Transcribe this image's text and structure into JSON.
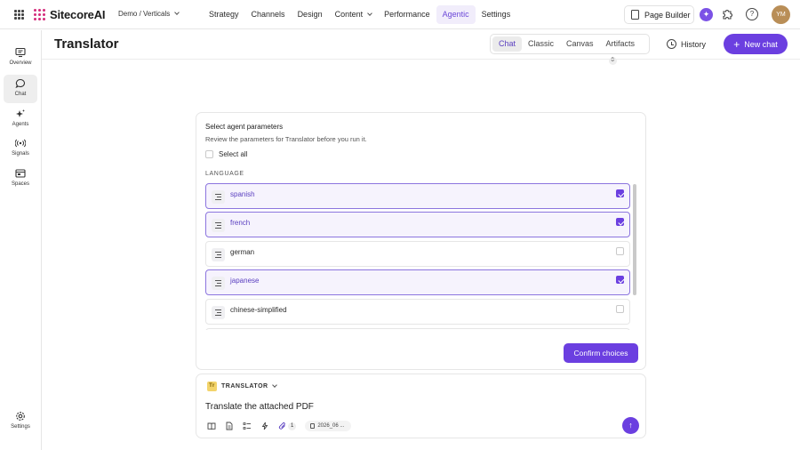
{
  "app": {
    "brand": "SitecoreAI",
    "site_switcher": "Demo / Verticals",
    "nav": [
      {
        "label": "Strategy"
      },
      {
        "label": "Channels"
      },
      {
        "label": "Design"
      },
      {
        "label": "Content"
      },
      {
        "label": "Performance"
      },
      {
        "label": "Agentic",
        "active": true
      },
      {
        "label": "Settings"
      }
    ],
    "page_builder_label": "Page Builder",
    "avatar_initials": "YM",
    "accent_color": "#6b3fe0"
  },
  "rail": {
    "items": [
      {
        "label": "Overview",
        "icon": "overview-icon"
      },
      {
        "label": "Chat",
        "icon": "chat-icon",
        "active": true
      },
      {
        "label": "Agents",
        "icon": "sparkles-icon"
      },
      {
        "label": "Signals",
        "icon": "signal-icon"
      },
      {
        "label": "Spaces",
        "icon": "spaces-icon"
      }
    ],
    "settings_label": "Settings"
  },
  "header": {
    "title": "Translator",
    "view_tabs": [
      {
        "label": "Chat",
        "active": true
      },
      {
        "label": "Classic"
      },
      {
        "label": "Canvas"
      },
      {
        "label": "Artifacts",
        "badge": "0"
      }
    ],
    "history_label": "History",
    "new_chat_label": "New chat"
  },
  "params": {
    "title": "Select agent parameters",
    "subtitle": "Review the parameters for Translator before you run it.",
    "select_all_label": "Select all",
    "section_label": "LANGUAGE",
    "options": [
      {
        "label": "spanish",
        "checked": true
      },
      {
        "label": "french",
        "checked": true
      },
      {
        "label": "german",
        "checked": false
      },
      {
        "label": "japanese",
        "checked": true
      },
      {
        "label": "chinese-simplified",
        "checked": false
      },
      {
        "label": "",
        "checked": false
      }
    ],
    "confirm_label": "Confirm choices"
  },
  "composer": {
    "agent_name": "TRANSLATOR",
    "agent_icon_text": "Tr",
    "prompt_text": "Translate the attached PDF",
    "attachment_count": "1",
    "file_name": "2026_06 ..."
  }
}
